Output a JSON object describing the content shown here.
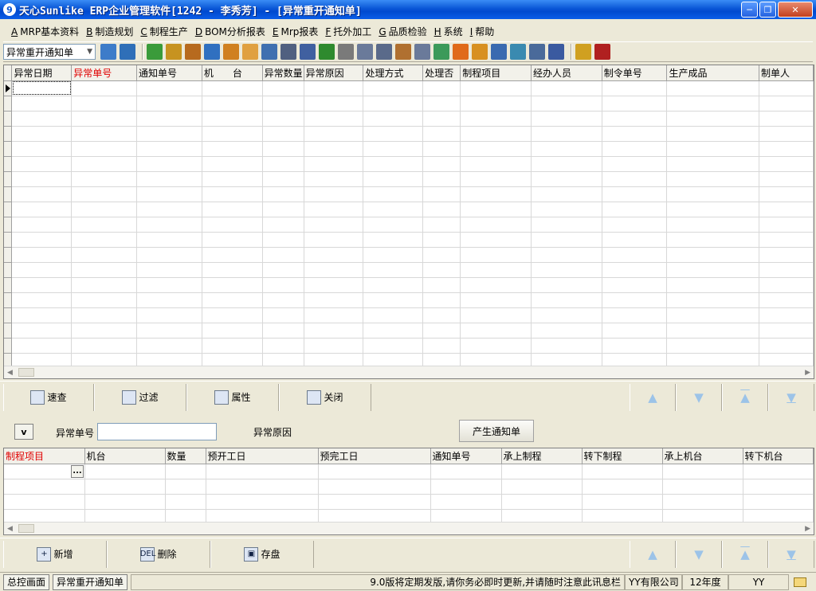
{
  "window": {
    "app_icon": "9",
    "title": "天心Sunlike ERP企业管理软件[1242 - 李秀芳] - [异常重开通知单]",
    "controls": [
      "minimize-icon",
      "restore-icon",
      "close-icon"
    ]
  },
  "menu": [
    {
      "key": "A",
      "label": "MRP基本资料"
    },
    {
      "key": "B",
      "label": "制造规划"
    },
    {
      "key": "C",
      "label": "制程生产"
    },
    {
      "key": "D",
      "label": "BOM分析报表"
    },
    {
      "key": "E",
      "label": "Mrp报表"
    },
    {
      "key": "F",
      "label": "托外加工"
    },
    {
      "key": "G",
      "label": "品质检验"
    },
    {
      "key": "H",
      "label": "系统"
    },
    {
      "key": "I",
      "label": "帮助"
    }
  ],
  "toolbar": {
    "form_select": "异常重开通知单",
    "icons": [
      "switch-icon",
      "monitor-icon",
      "phone-icon",
      "tools-icon",
      "briefcase-icon",
      "home-icon",
      "users-icon",
      "folder-icon",
      "book-icon",
      "pin-icon",
      "help-icon",
      "money-icon",
      "cart-icon",
      "document-icon",
      "grid-icon",
      "package-icon",
      "copy-icon",
      "check-icon",
      "bell-icon",
      "org-chart-icon",
      "send-icon",
      "refresh-icon",
      "window-icon",
      "close-window-icon",
      "cascade-icon",
      "exit-icon"
    ]
  },
  "master_grid": {
    "columns": [
      {
        "label": "异常日期",
        "required": false
      },
      {
        "label": "异常单号",
        "required": true
      },
      {
        "label": "通知单号",
        "required": false
      },
      {
        "label": "机　　台",
        "required": false
      },
      {
        "label": "异常数量",
        "required": false
      },
      {
        "label": "异常原因",
        "required": false
      },
      {
        "label": "处理方式",
        "required": false
      },
      {
        "label": "处理否",
        "required": false
      },
      {
        "label": "制程项目",
        "required": false
      },
      {
        "label": "经办人员",
        "required": false
      },
      {
        "label": "制令单号",
        "required": false
      },
      {
        "label": "生产成品",
        "required": false
      },
      {
        "label": "制单人",
        "required": false
      }
    ]
  },
  "master_buttons": [
    {
      "label": "速查",
      "icon": "search-icon"
    },
    {
      "label": "过滤",
      "icon": "filter-icon"
    },
    {
      "label": "属性",
      "icon": "properties-icon"
    },
    {
      "label": "关闭",
      "icon": "close-icon"
    }
  ],
  "nav_buttons": [
    "arrow-up-icon",
    "arrow-down-icon",
    "first-icon",
    "last-icon"
  ],
  "detail_header": {
    "toggle": "v",
    "exception_no_label": "异常单号",
    "exception_no_value": "",
    "reason_label": "异常原因",
    "generate_button": "产生通知单"
  },
  "detail_grid": {
    "columns": [
      {
        "label": "制程项目",
        "required": true
      },
      {
        "label": "机台",
        "required": false
      },
      {
        "label": "数量",
        "required": false
      },
      {
        "label": "预开工日",
        "required": false
      },
      {
        "label": "预完工日",
        "required": false
      },
      {
        "label": "通知单号",
        "required": false
      },
      {
        "label": "承上制程",
        "required": false
      },
      {
        "label": "转下制程",
        "required": false
      },
      {
        "label": "承上机台",
        "required": false
      },
      {
        "label": "转下机台",
        "required": false
      }
    ],
    "ellipsis": "..."
  },
  "detail_buttons": [
    {
      "label": "新增",
      "icon": "add-icon",
      "glyph": "+"
    },
    {
      "label": "删除",
      "icon": "delete-icon",
      "glyph": "DEL"
    },
    {
      "label": "存盘",
      "icon": "save-icon",
      "glyph": "▣"
    }
  ],
  "status": {
    "tabs": [
      "总控画面",
      "异常重开通知单"
    ],
    "notice": "9.0版将定期发版,请你务必即时更新,并请随时注意此讯息栏",
    "company": "YY有限公司",
    "year": "12年度",
    "user": "YY"
  }
}
